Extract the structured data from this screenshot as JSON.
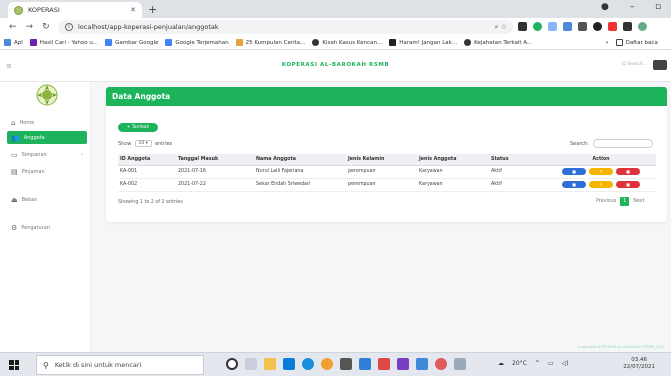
{
  "browser": {
    "tab_title": "KOPERASI",
    "url": "localhost/app-koperasi-penjualan/anggotak",
    "bookmarks": [
      "Apl",
      "Hasil Cari - Yahoo u...",
      "Gambar Google",
      "Google Terjemahan",
      "25 Kumpulan Cerita...",
      "Kisah Kasus Kencan...",
      "Haram! Jangan Lak...",
      "Kejahatan Terkait A...",
      "Daftar baca"
    ],
    "bookmarks_more": "»"
  },
  "header": {
    "brand": "KOPERASI AL-BAROKAH RSMB",
    "search_placeholder": "Q Search..."
  },
  "sidebar": {
    "items": [
      {
        "label": "Home",
        "icon": "home-icon"
      },
      {
        "label": "Anggota",
        "icon": "users-icon"
      },
      {
        "label": "Simpanan",
        "icon": "piggy-bank-icon"
      },
      {
        "label": "Pinjaman",
        "icon": "money-icon"
      },
      {
        "label": "Bebas",
        "icon": "eject-icon"
      },
      {
        "label": "Pengaturan",
        "icon": "gear-icon"
      }
    ]
  },
  "main": {
    "title": "Data Anggota",
    "add_label": "+ Tambah",
    "show_label": "Show",
    "entries_value": "10",
    "entries_label": "entries",
    "search_label": "Search:",
    "columns": [
      "ID Anggota",
      "Tanggal Masuk",
      "Nama Anggota",
      "Jenis Kelamin",
      "Jenis Anggota",
      "Status",
      "Action"
    ],
    "rows": [
      [
        "KA-001",
        "2021-07-16",
        "Nurul Laili Fajeriana",
        "perempuan",
        "Karyawan",
        "Aktif"
      ],
      [
        "KA-002",
        "2021-07-22",
        "Sekar Endah Sriwedari",
        "perempuan",
        "Karyawan",
        "Aktif"
      ]
    ],
    "showing_text": "Showing 1 to 2 of 2 entries",
    "pager": {
      "prev": "Previous",
      "current": "1",
      "next": "Next"
    }
  },
  "footer": {
    "copyright": "Copyright KOPERASI AL-BAROKAH RSMB 2021"
  },
  "taskbar": {
    "search_placeholder": "Ketik di sini untuk mencari",
    "temperature": "20°C",
    "time": "03.46",
    "date": "22/07/2021"
  },
  "colors": {
    "accent": "#1cb35b",
    "info": "#2f6fd6",
    "warning": "#f5b400",
    "danger": "#e0323a"
  }
}
